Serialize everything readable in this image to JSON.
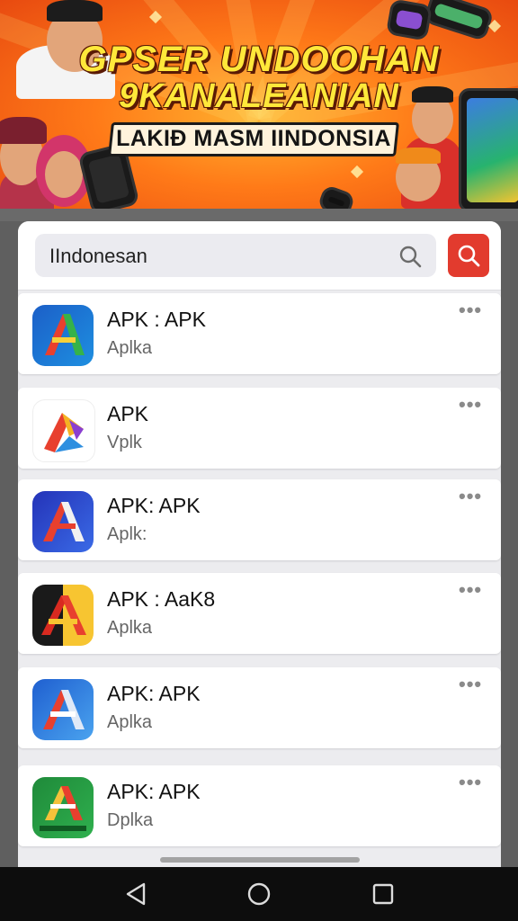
{
  "banner": {
    "line1": "GPSER UNDOOHAN",
    "line2": "9KANALEANIAN",
    "ribbon": "LAKIÐ MASM IINDONSIA"
  },
  "search": {
    "query": "IIndonesan",
    "icon": "search-icon",
    "button_icon": "search-icon",
    "button_color": "#e23b2e"
  },
  "apps": [
    {
      "title": "APK : APK",
      "subtitle": "Aplka",
      "icon_style": "blue-green"
    },
    {
      "title": "APK",
      "subtitle": "Vplk",
      "icon_style": "multicolor"
    },
    {
      "title": "APK: APK",
      "subtitle": "Aplk:",
      "icon_style": "blue-red"
    },
    {
      "title": "APK : AaK8",
      "subtitle": "Aplka",
      "icon_style": "black-gold"
    },
    {
      "title": "APK: APK",
      "subtitle": "Aplka",
      "icon_style": "blue-light"
    },
    {
      "title": "APK: APK",
      "subtitle": "Dplka",
      "icon_style": "green"
    }
  ],
  "more_label": "•••",
  "nav": {
    "back": "back-icon",
    "home": "home-icon",
    "recents": "recents-icon"
  }
}
